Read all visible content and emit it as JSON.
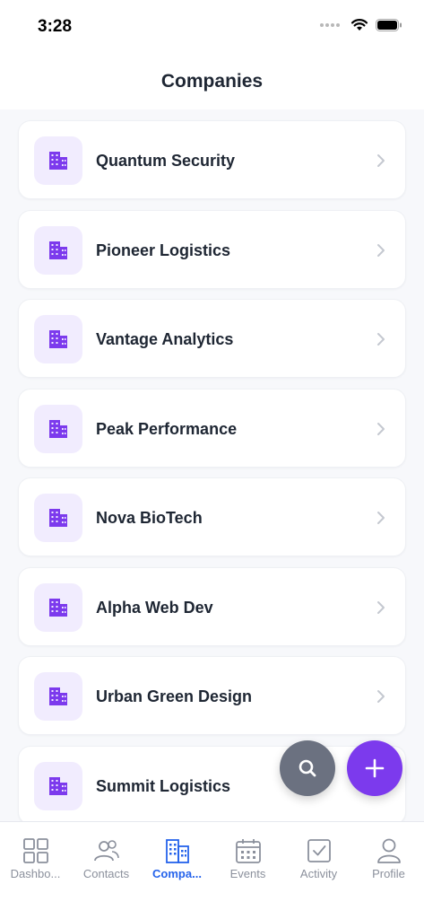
{
  "status_bar": {
    "time": "3:28"
  },
  "header": {
    "title": "Companies"
  },
  "companies": [
    {
      "name": "Quantum Security"
    },
    {
      "name": "Pioneer Logistics"
    },
    {
      "name": "Vantage Analytics"
    },
    {
      "name": "Peak Performance"
    },
    {
      "name": "Nova BioTech"
    },
    {
      "name": "Alpha Web Dev"
    },
    {
      "name": "Urban Green Design"
    },
    {
      "name": "Summit Logistics"
    }
  ],
  "fabs": {
    "search_icon": "search-icon",
    "add_icon": "plus-icon"
  },
  "tabs": [
    {
      "label": "Dashbo...",
      "icon": "grid-icon",
      "active": false
    },
    {
      "label": "Contacts",
      "icon": "people-icon",
      "active": false
    },
    {
      "label": "Compa...",
      "icon": "building-icon",
      "active": true
    },
    {
      "label": "Events",
      "icon": "calendar-icon",
      "active": false
    },
    {
      "label": "Activity",
      "icon": "checkbox-icon",
      "active": false
    },
    {
      "label": "Profile",
      "icon": "person-icon",
      "active": false
    }
  ],
  "colors": {
    "accent_purple": "#7c3aed",
    "icon_bg": "#f1ecfe",
    "active_tab": "#2563eb",
    "inactive_tab": "#8b909c",
    "search_fab": "#6b7180"
  }
}
